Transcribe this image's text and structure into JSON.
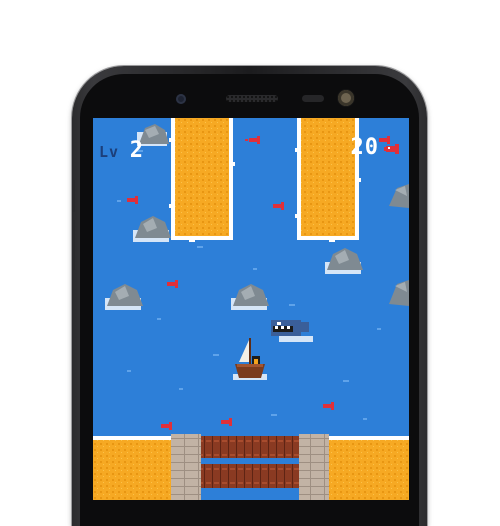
{
  "hud": {
    "level_label": "Lv",
    "level_value": "2",
    "score_value": "20",
    "score_icon": "fish-icon"
  },
  "colors": {
    "water": "#2d7fd8",
    "sand": "#f6a923",
    "sand_dark": "#e08a10",
    "foam": "#ffffff",
    "rock": "#7f8a92",
    "fish": "#e0303a",
    "dock": "#8a3a22",
    "stone": "#b9a89a",
    "shark": "#3a5f9a"
  },
  "entities": {
    "player": "boat-with-penguin",
    "enemy": "shark",
    "obstacles": "rocks",
    "collectibles": "fish"
  }
}
